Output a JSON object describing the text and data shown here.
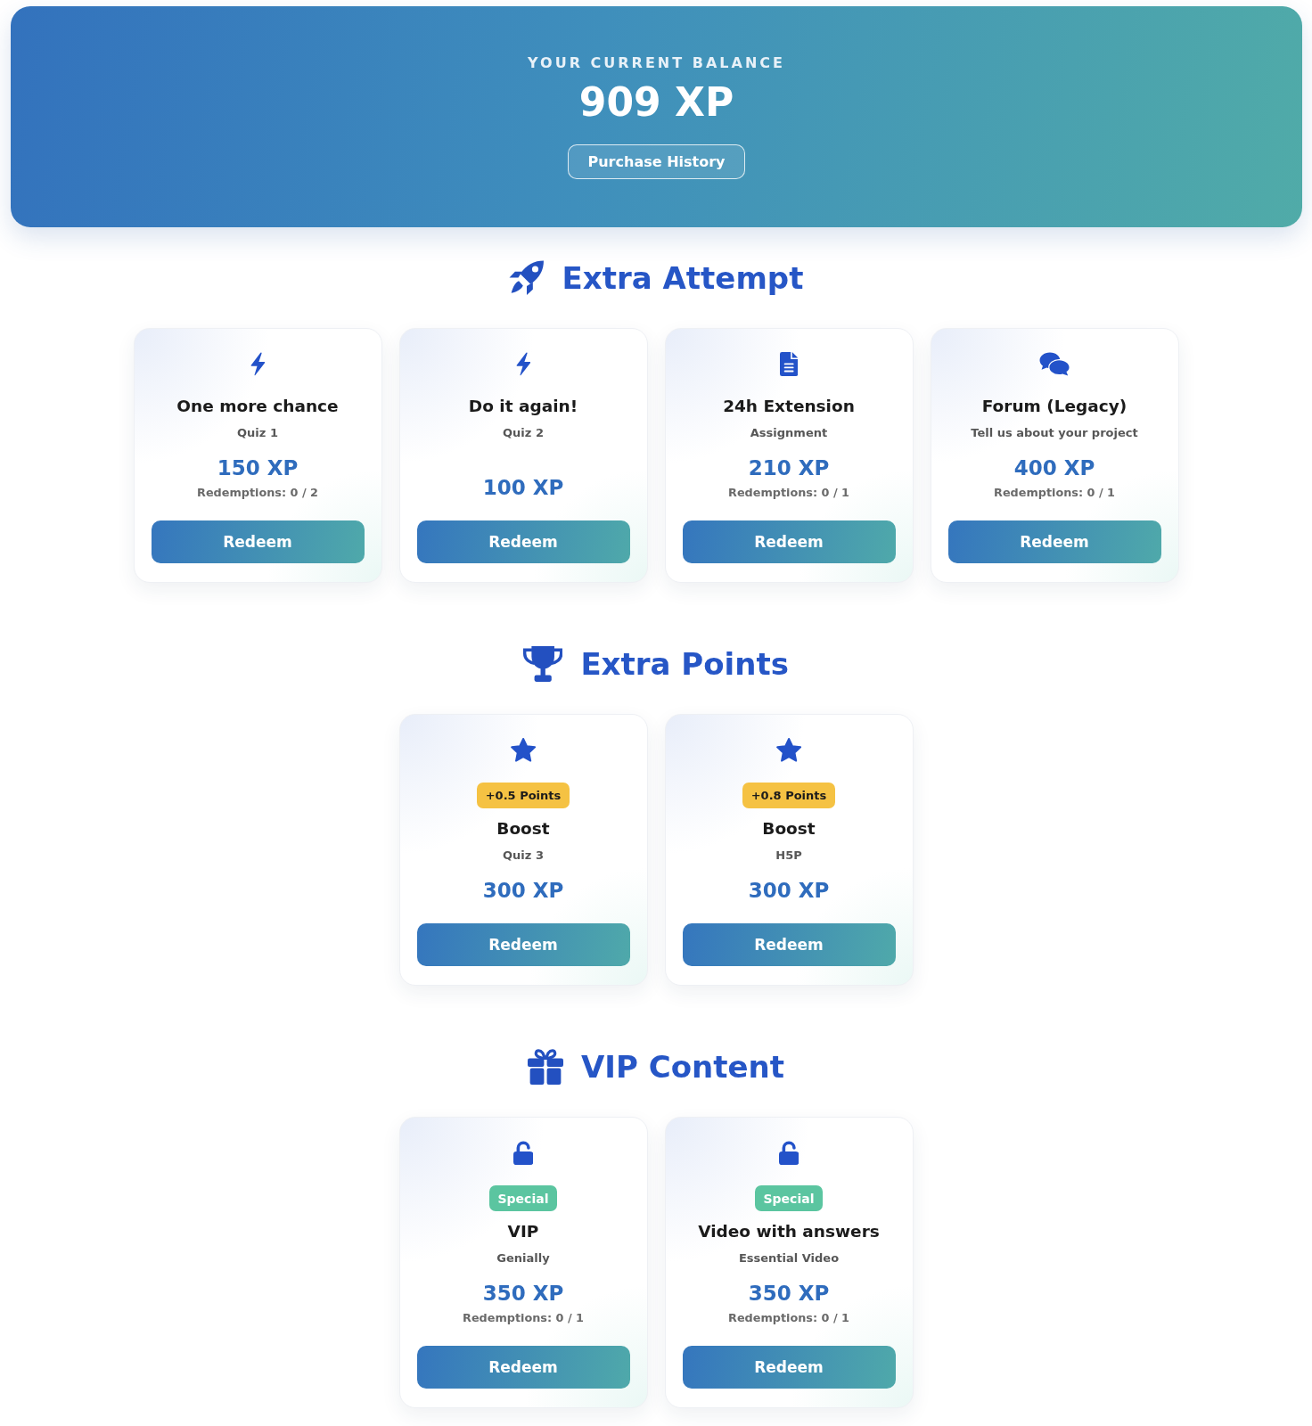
{
  "balance": {
    "label": "YOUR CURRENT BALANCE",
    "amount": "909 XP",
    "history_button": "Purchase History"
  },
  "sections": [
    {
      "kind": "attempt",
      "title": "Extra Attempt",
      "rewards": [
        {
          "kind": "attempt",
          "title": "One more chance",
          "target": "Quiz 1",
          "price": "150 XP",
          "redemptions": "Redemptions: 0 / 2",
          "button": "Redeem"
        },
        {
          "kind": "attempt",
          "title": "Do it again!",
          "target": "Quiz 2",
          "price": "100 XP",
          "button": "Redeem"
        },
        {
          "kind": "extension",
          "title": "24h Extension",
          "target": "Assignment",
          "price": "210 XP",
          "redemptions": "Redemptions: 0 / 1",
          "button": "Redeem"
        },
        {
          "kind": "forum",
          "title": "Forum (Legacy)",
          "target": "Tell us about your project",
          "price": "400 XP",
          "redemptions": "Redemptions: 0 / 1",
          "button": "Redeem"
        }
      ]
    },
    {
      "kind": "points",
      "title": "Extra Points",
      "rewards": [
        {
          "kind": "points",
          "tag": {
            "kind": "points",
            "text": "+0.5 Points"
          },
          "title": "Boost",
          "target": "Quiz 3",
          "price": "300 XP",
          "button": "Redeem"
        },
        {
          "kind": "points",
          "tag": {
            "kind": "points",
            "text": "+0.8 Points"
          },
          "title": "Boost",
          "target": "H5P",
          "price": "300 XP",
          "button": "Redeem"
        }
      ]
    },
    {
      "kind": "content",
      "title": "VIP Content",
      "rewards": [
        {
          "kind": "unlock",
          "tag": {
            "kind": "special",
            "text": "Special"
          },
          "title": "VIP",
          "target": "Genially",
          "price": "350 XP",
          "redemptions": "Redemptions: 0 / 1",
          "button": "Redeem"
        },
        {
          "kind": "unlock",
          "tag": {
            "kind": "special",
            "text": "Special"
          },
          "title": "Video with answers",
          "target": "Essential Video",
          "price": "350 XP",
          "redemptions": "Redemptions: 0 / 1",
          "button": "Redeem"
        }
      ]
    }
  ]
}
